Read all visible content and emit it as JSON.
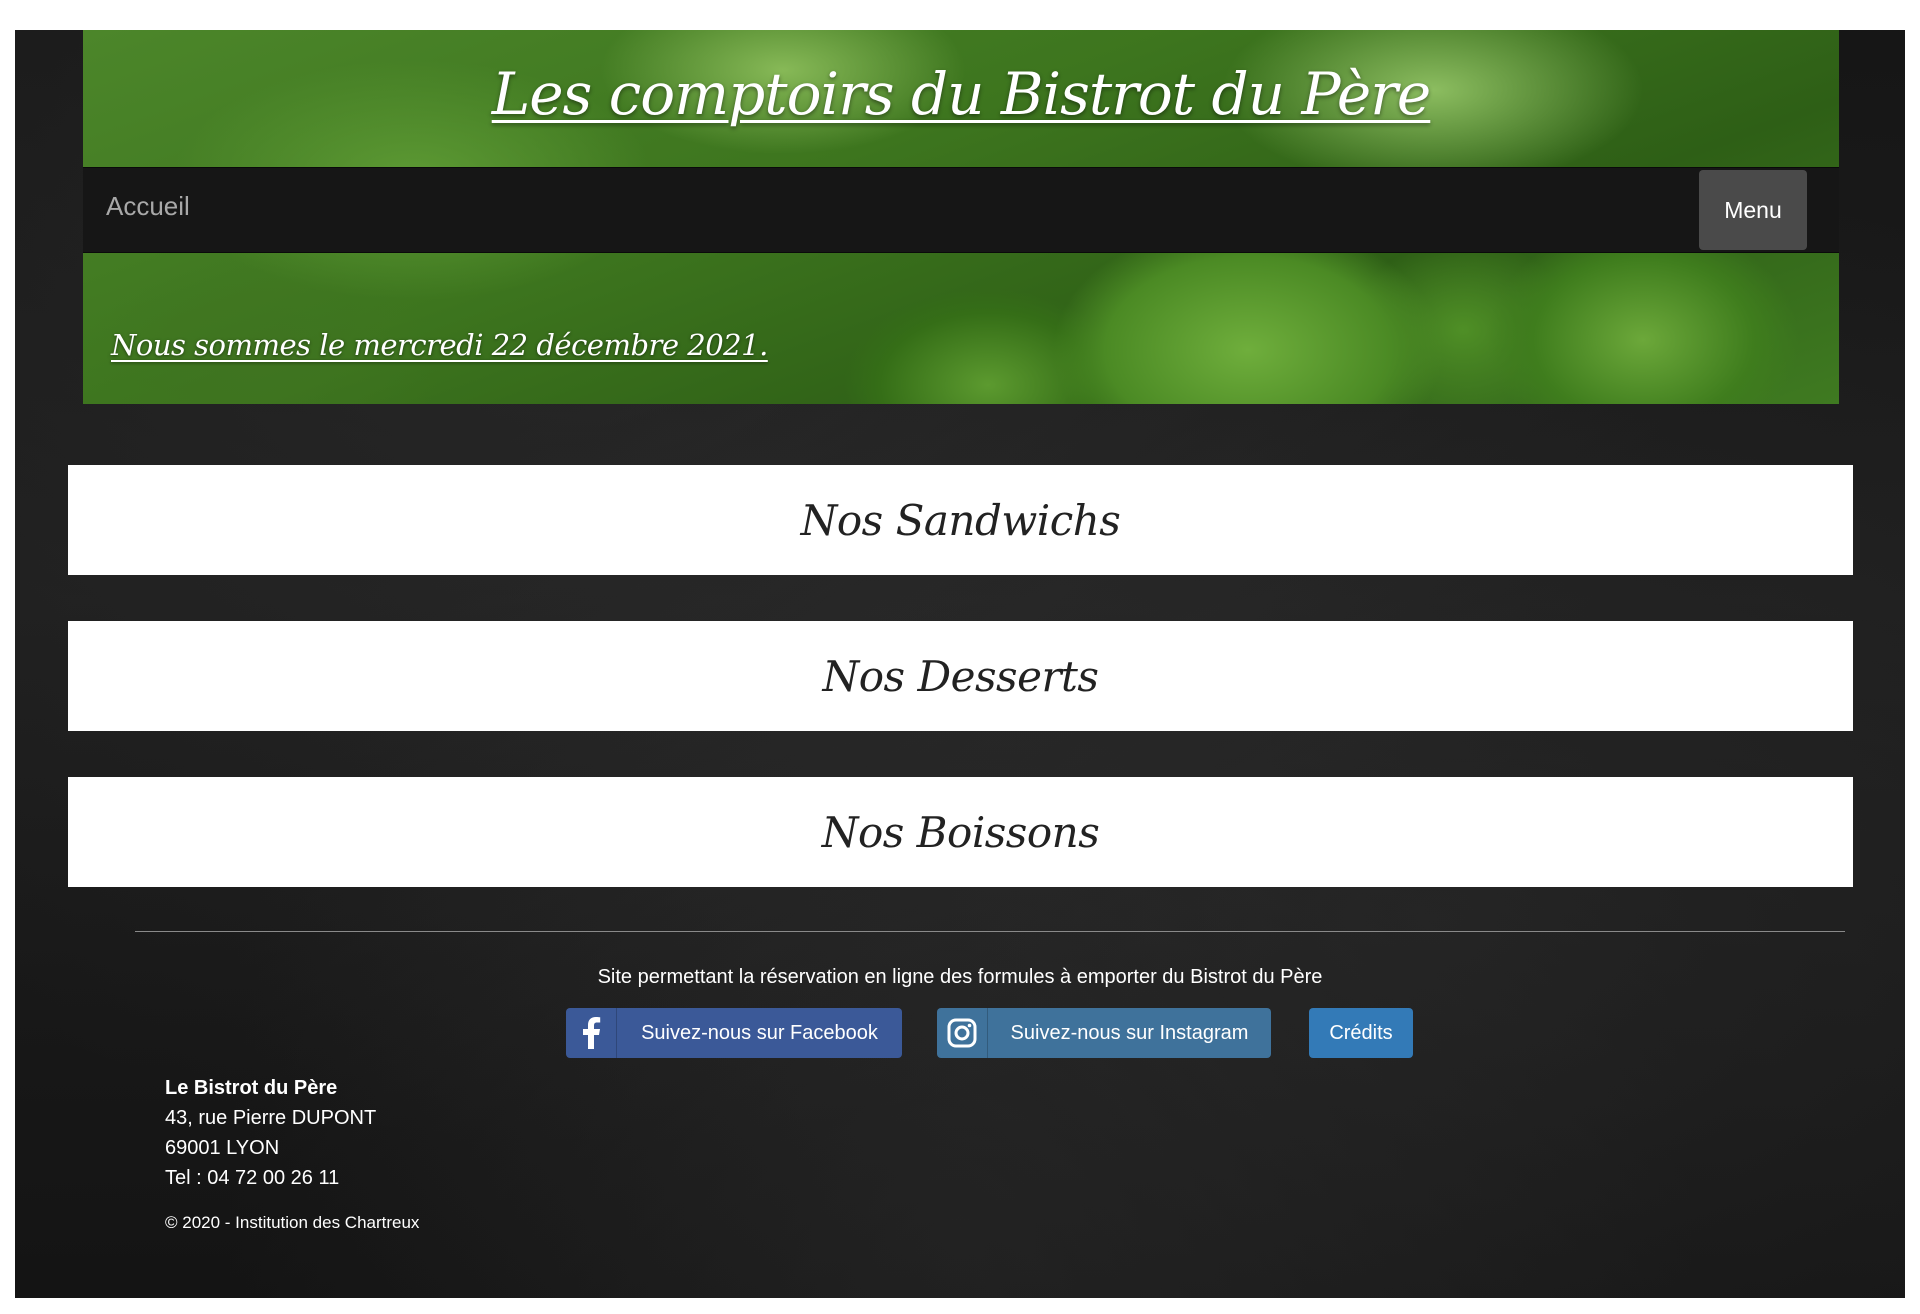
{
  "header": {
    "title": "Les comptoirs du Bistrot du Père",
    "date_text": "Nous sommes le mercredi 22 décembre 2021."
  },
  "nav": {
    "home_label": "Accueil",
    "menu_label": "Menu"
  },
  "categories": [
    {
      "label": "Nos Sandwichs"
    },
    {
      "label": "Nos Desserts"
    },
    {
      "label": "Nos Boissons"
    }
  ],
  "footer": {
    "tagline": "Site permettant la réservation en ligne des formules à emporter du Bistrot du Père",
    "buttons": {
      "facebook_label": "Suivez-nous sur Facebook",
      "facebook_icon": "facebook-icon",
      "facebook_color": "#3b5998",
      "instagram_label": "Suivez-nous sur Instagram",
      "instagram_icon": "instagram-icon",
      "instagram_color": "#3f729b",
      "credits_label": "Crédits",
      "credits_color": "#337ab7"
    },
    "address": {
      "name": "Le Bistrot du Père",
      "street": "43, rue Pierre DUPONT",
      "city": "69001 LYON",
      "phone": "Tel : 04 72 00 26 11"
    },
    "copyright": "© 2020 - Institution des Chartreux"
  }
}
